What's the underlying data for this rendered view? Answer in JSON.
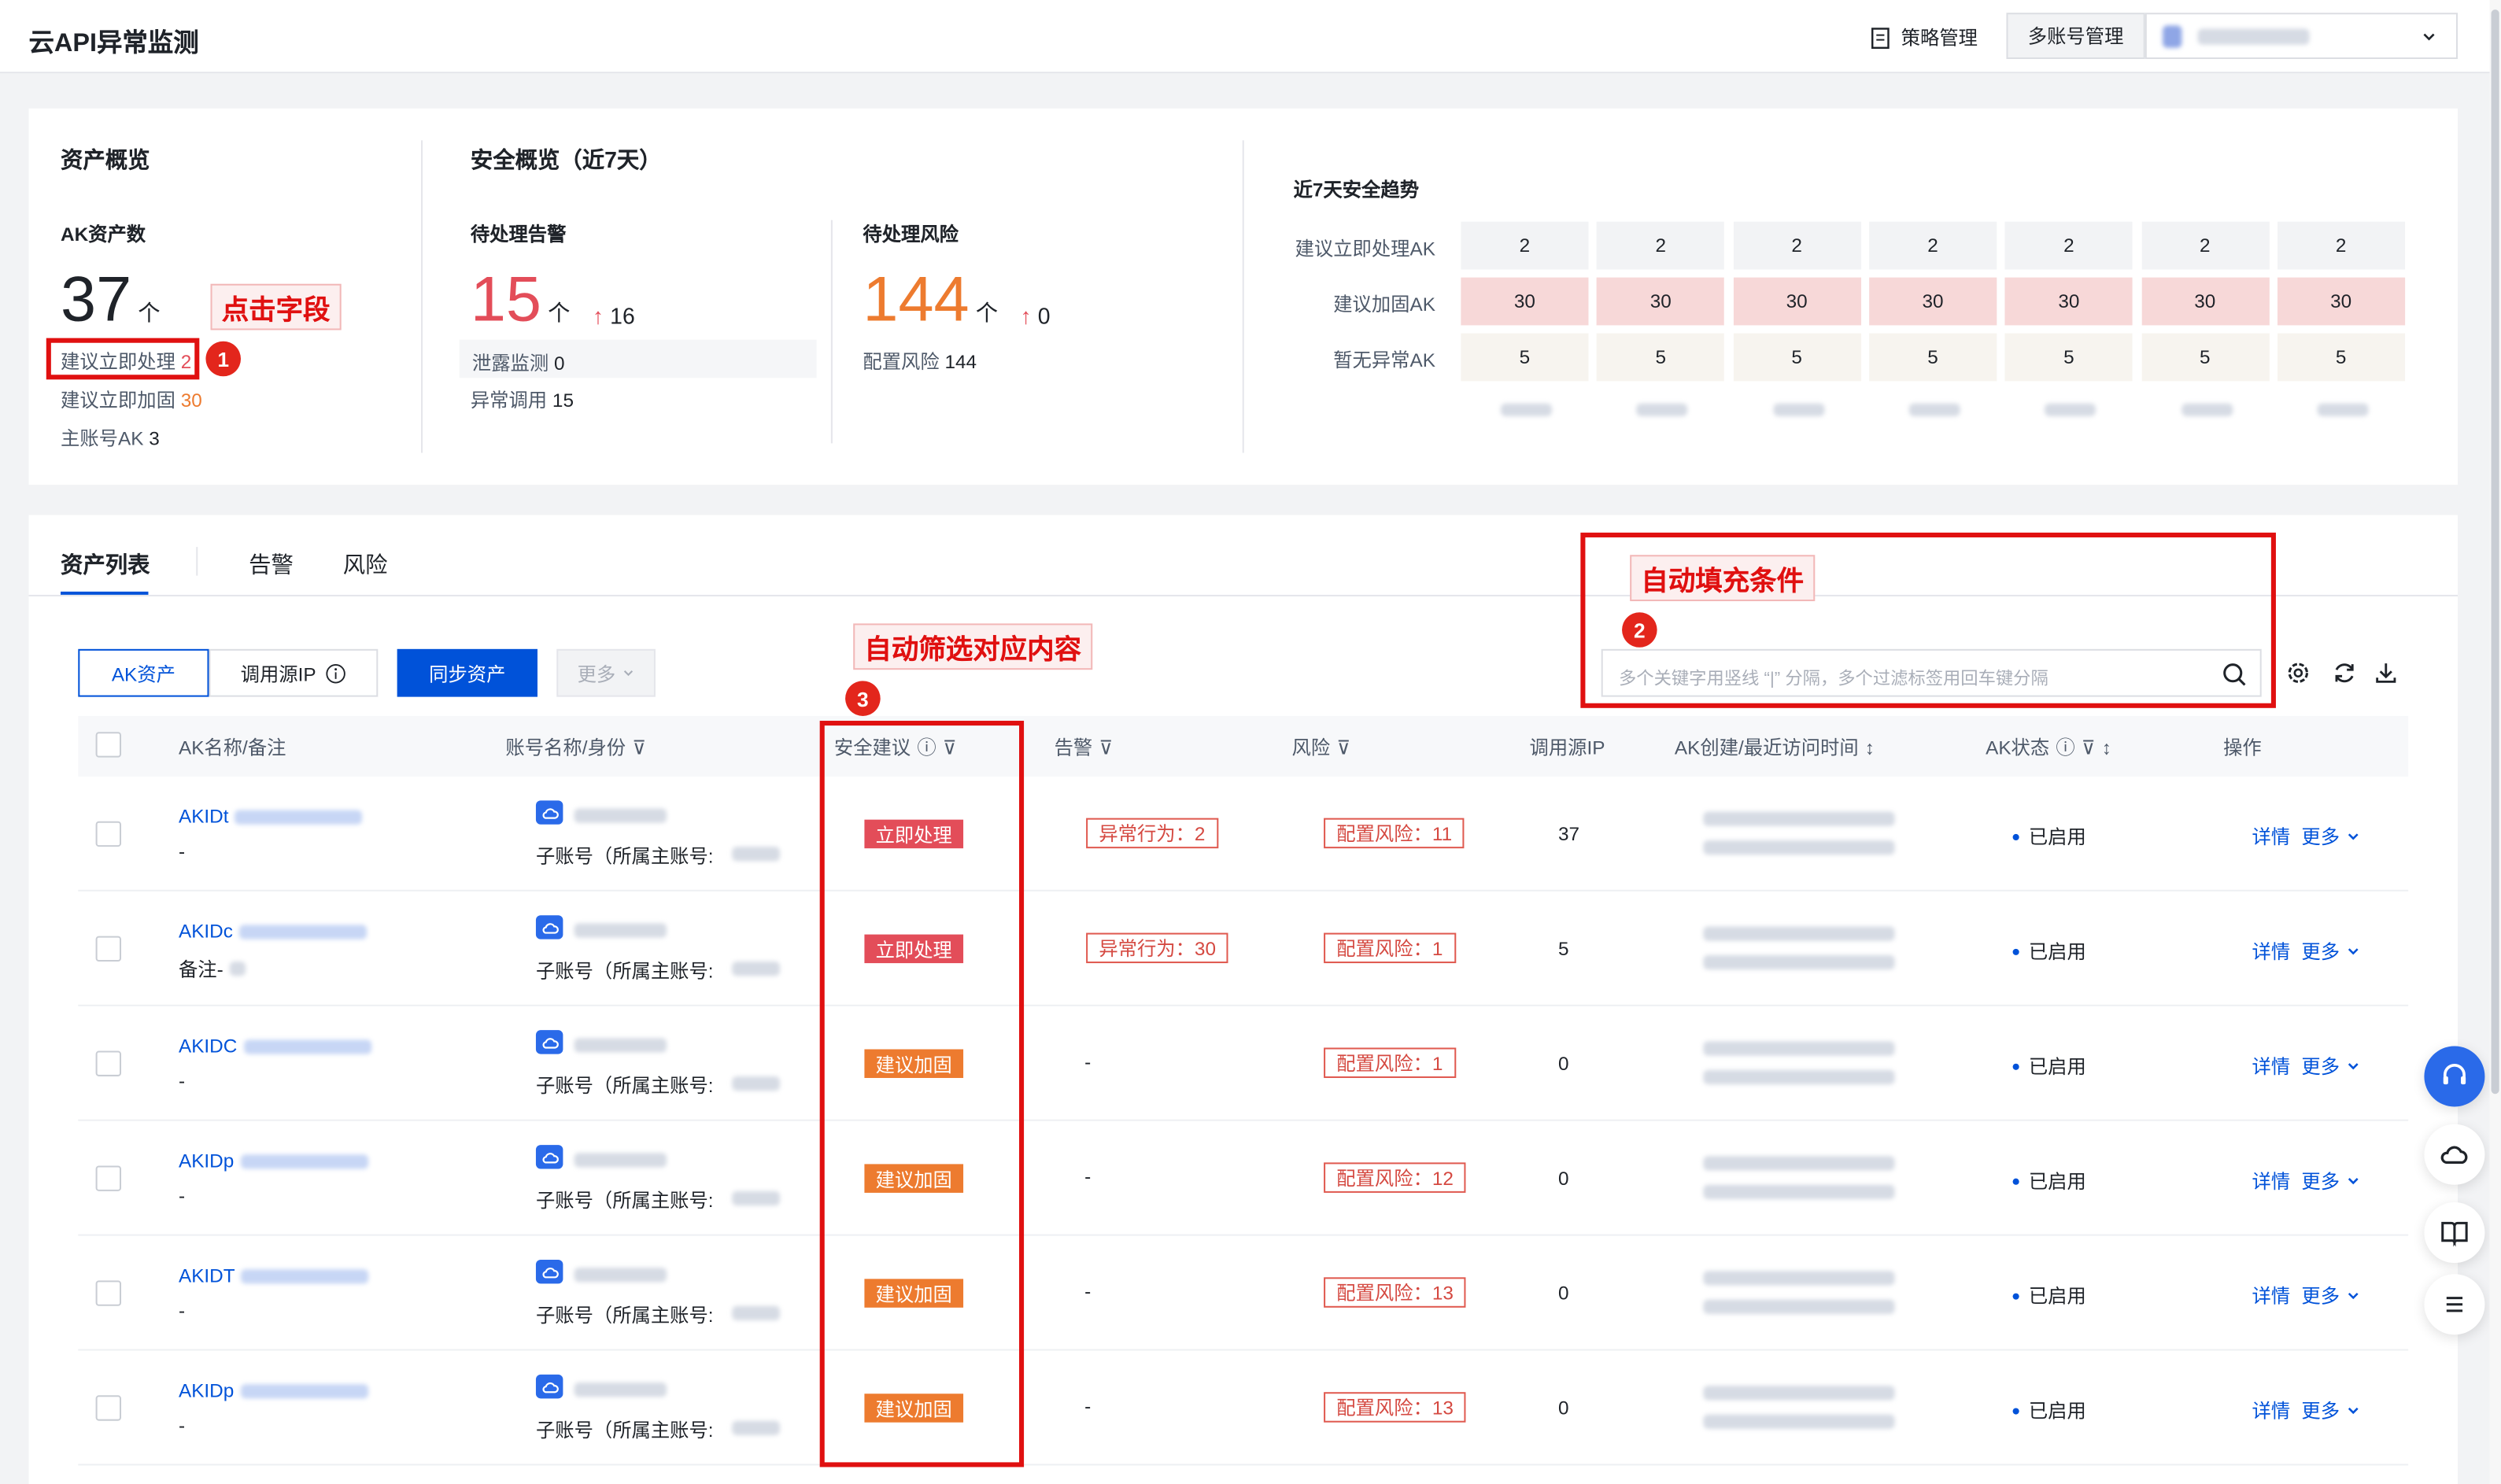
{
  "header": {
    "title": "云API异常监测",
    "policy_label": "策略管理",
    "multi_account_label": "多账号管理"
  },
  "asset_overview": {
    "title": "资产概览",
    "ak_label": "AK资产数",
    "ak_count": "37",
    "unit": "个",
    "immediate_label": "建议立即处理",
    "immediate_value": "2",
    "harden_label": "建议立即加固",
    "harden_value": "30",
    "main_label": "主账号AK",
    "main_value": "3"
  },
  "security_overview": {
    "title": "安全概览（近7天）",
    "alerts_label": "待处理告警",
    "alerts_count": "15",
    "unit": "个",
    "alerts_delta": "16",
    "leak_label": "泄露监测",
    "leak_value": "0",
    "abnormal_label": "异常调用",
    "abnormal_value": "15",
    "risk_label": "待处理风险",
    "risk_count": "144",
    "risk_delta": "0",
    "config_label": "配置风险",
    "config_value": "144"
  },
  "trend": {
    "title": "近7天安全趋势",
    "rows": [
      {
        "label": "建议立即处理AK",
        "values": [
          "2",
          "2",
          "2",
          "2",
          "2",
          "2",
          "2"
        ]
      },
      {
        "label": "建议加固AK",
        "values": [
          "30",
          "30",
          "30",
          "30",
          "30",
          "30",
          "30"
        ]
      },
      {
        "label": "暂无异常AK",
        "values": [
          "5",
          "5",
          "5",
          "5",
          "5",
          "5",
          "5"
        ]
      }
    ]
  },
  "annotations": {
    "a1": "点击字段",
    "a2": "自动填充条件",
    "a3": "自动筛选对应内容",
    "b1": "1",
    "b2": "2",
    "b3": "3"
  },
  "tabs": [
    "资产列表",
    "告警",
    "风险"
  ],
  "toolbar": {
    "ak_asset": "AK资产",
    "source_ip": "调用源IP",
    "sync": "同步资产",
    "more": "更多",
    "search_placeholder": "多个关键字用竖线 “|” 分隔，多个过滤标签用回车键分隔"
  },
  "columns": {
    "name": "AK名称/备注",
    "account": "账号名称/身份",
    "suggest": "安全建议",
    "alert": "告警",
    "risk": "风险",
    "ip": "调用源IP",
    "time": "AK创建/最近访问时间",
    "status": "AK状态",
    "ops": "操作"
  },
  "rows": [
    {
      "ak": "AKIDt",
      "note": "-",
      "identity": "子账号（所属主账号:",
      "suggest": "立即处理",
      "alert": "异常行为：2",
      "risk": "配置风险：11",
      "ip": "37",
      "status": "已启用",
      "detail": "详情",
      "more": "更多"
    },
    {
      "ak": "AKIDc",
      "note": "备注-",
      "identity": "子账号（所属主账号:",
      "suggest": "立即处理",
      "alert": "异常行为：30",
      "risk": "配置风险：1",
      "ip": "5",
      "status": "已启用",
      "detail": "详情",
      "more": "更多"
    },
    {
      "ak": "AKIDC",
      "note": "-",
      "identity": "子账号（所属主账号:",
      "suggest": "建议加固",
      "alert": "-",
      "risk": "配置风险：1",
      "ip": "0",
      "status": "已启用",
      "detail": "详情",
      "more": "更多"
    },
    {
      "ak": "AKIDp",
      "note": "-",
      "identity": "子账号（所属主账号:",
      "suggest": "建议加固",
      "alert": "-",
      "risk": "配置风险：12",
      "ip": "0",
      "status": "已启用",
      "detail": "详情",
      "more": "更多"
    },
    {
      "ak": "AKIDT",
      "note": "-",
      "identity": "子账号（所属主账号:",
      "suggest": "建议加固",
      "alert": "-",
      "risk": "配置风险：13",
      "ip": "0",
      "status": "已启用",
      "detail": "详情",
      "more": "更多"
    },
    {
      "ak": "AKIDp",
      "note": "-",
      "identity": "子账号（所属主账号:",
      "suggest": "建议加固",
      "alert": "-",
      "risk": "配置风险：13",
      "ip": "0",
      "status": "已启用",
      "detail": "详情",
      "more": "更多"
    }
  ],
  "colors": {
    "primary": "#0052d9",
    "danger": "#e34d59",
    "warning": "#ed7b2f",
    "annotation": "#e01010"
  }
}
